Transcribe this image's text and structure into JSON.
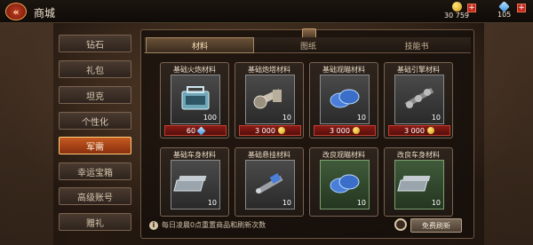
{
  "header": {
    "back_label": "«",
    "title": "商城"
  },
  "resources": {
    "gold": "30 759",
    "gems": "105",
    "plus": "+"
  },
  "sidebar": {
    "items": [
      {
        "label": "钻石"
      },
      {
        "label": "礼包"
      },
      {
        "label": "坦克"
      },
      {
        "label": "个性化"
      },
      {
        "label": "军需",
        "active": true
      },
      {
        "label": "幸运宝箱"
      },
      {
        "label": "高级账号"
      },
      {
        "label": "赠礼"
      }
    ]
  },
  "tabs": [
    {
      "label": "材料",
      "active": true
    },
    {
      "label": "图纸"
    },
    {
      "label": "技能书"
    }
  ],
  "cards": [
    {
      "name": "基础火炮材料",
      "qty": "100",
      "price": "60",
      "currency": "gem",
      "icon": "toolbox-icon"
    },
    {
      "name": "基础炮塔材料",
      "qty": "10",
      "price": "3 000",
      "currency": "gold",
      "icon": "wrench-icon"
    },
    {
      "name": "基础观瞄材料",
      "qty": "10",
      "price": "3 000",
      "currency": "gold",
      "icon": "lens-icon"
    },
    {
      "name": "基础引擎材料",
      "qty": "10",
      "price": "3 000",
      "currency": "gold",
      "icon": "crankshaft-icon"
    },
    {
      "name": "基础车身材料",
      "qty": "10",
      "icon": "steel-plate-icon"
    },
    {
      "name": "基础悬挂材料",
      "qty": "10",
      "icon": "shock-absorber-icon"
    },
    {
      "name": "改良观瞄材料",
      "qty": "10",
      "icon": "lens-icon"
    },
    {
      "name": "改良车身材料",
      "qty": "10",
      "icon": "steel-plate-icon"
    }
  ],
  "footer": {
    "note": "每日凌晨0点重置商品和刷新次数",
    "refresh_label": "免费刷新"
  },
  "colors": {
    "accent": "#c65a22",
    "price_red": "#8a1a14",
    "gold": "#d49a10",
    "gem": "#3a8fe0"
  }
}
